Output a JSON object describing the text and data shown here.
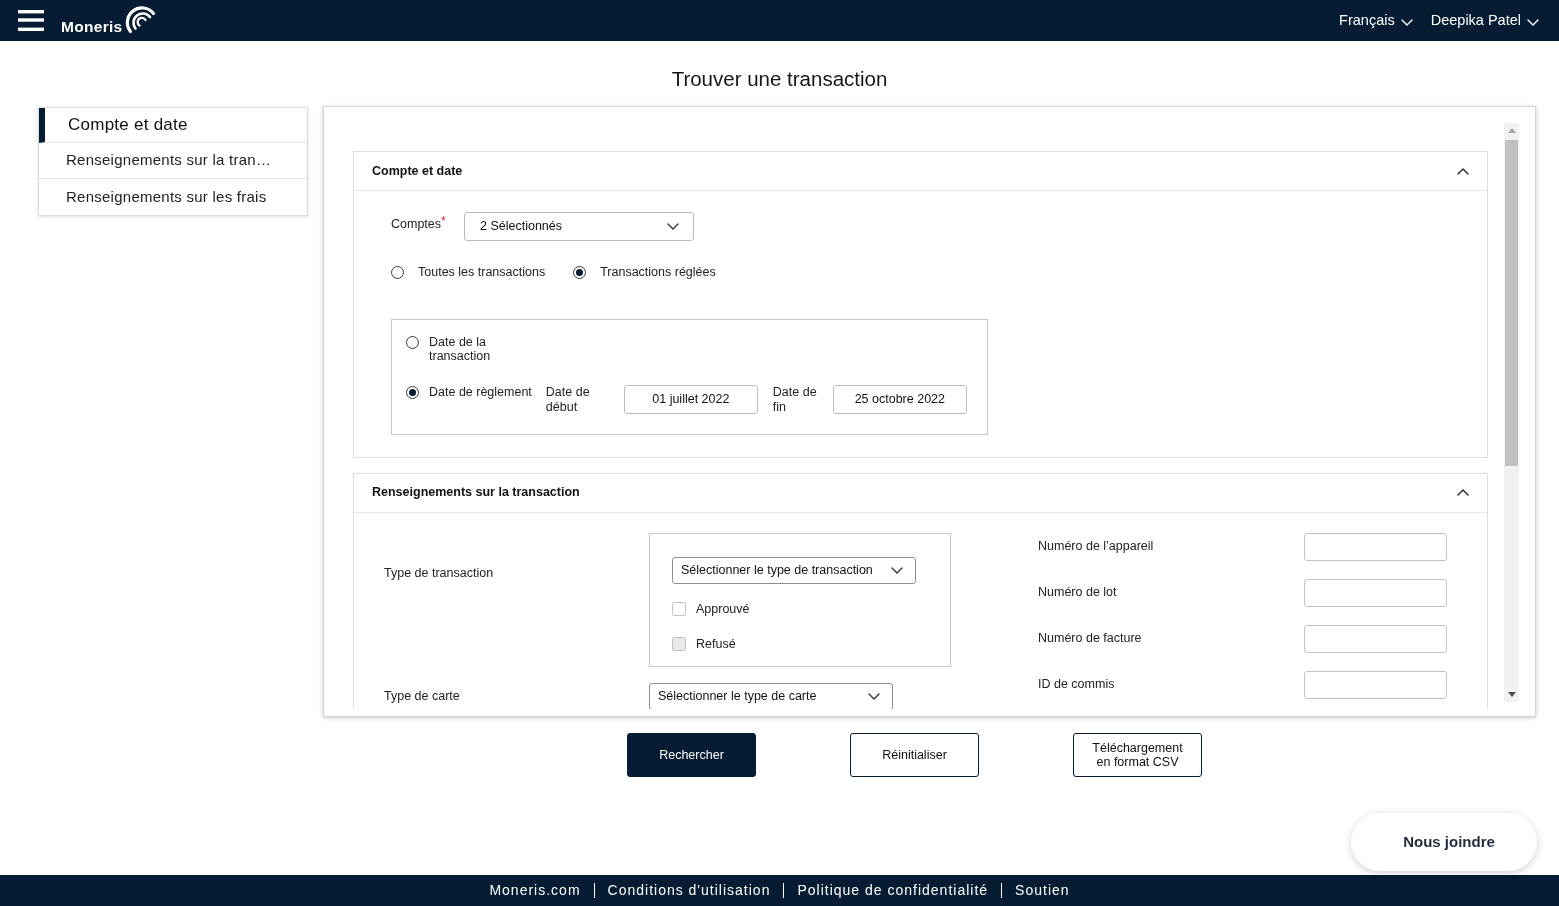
{
  "header": {
    "brand": "Moneris",
    "language": "Français",
    "user": "Deepika Patel"
  },
  "page_title": "Trouver une transaction",
  "sidebar": {
    "items": [
      {
        "label": "Compte et date",
        "selected": true
      },
      {
        "label": "Renseignements sur la tran…",
        "selected": false
      },
      {
        "label": "Renseignements sur les frais",
        "selected": false
      }
    ]
  },
  "sections": [
    {
      "kind": "account_date",
      "title": "Compte et date",
      "expanded": true,
      "accounts": {
        "label": "Comptes",
        "required_mark": "*",
        "value": "2 Sélectionnés"
      },
      "scope_options": [
        {
          "label": "Toutes les transactions",
          "selected": false
        },
        {
          "label": "Transactions réglées",
          "selected": true
        }
      ],
      "date_options": [
        {
          "label": "Date de la transaction",
          "selected": false
        },
        {
          "label": "Date de règlement",
          "selected": true,
          "start": {
            "label": "Date de début",
            "value": "01 juillet 2022"
          },
          "end": {
            "label": "Date de fin",
            "value": "25 octobre 2022"
          }
        }
      ]
    },
    {
      "kind": "transaction",
      "title": "Renseignements sur la transaction",
      "expanded": true,
      "transaction_type": {
        "label": "Type de transaction",
        "value": "Sélectionner le type de transaction",
        "statuses": [
          {
            "label": "Approuvé",
            "checked": false,
            "disabled": false
          },
          {
            "label": "Refusé",
            "checked": false,
            "disabled": true
          }
        ]
      },
      "card_type": {
        "label": "Type de carte",
        "value": "Sélectionner le type de carte"
      },
      "fields": [
        {
          "label": "Numéro de l’appareil"
        },
        {
          "label": "Numéro de lot"
        },
        {
          "label": "Numéro de facture"
        },
        {
          "label": "ID de commis"
        }
      ]
    }
  ],
  "actions": [
    {
      "label": "Rechercher",
      "kind": "primary"
    },
    {
      "label": "Réinitialiser",
      "kind": "secondary"
    },
    {
      "label": "Téléchargement en format CSV",
      "kind": "secondary"
    }
  ],
  "contact_button": "Nous joindre",
  "footer": {
    "links": [
      "Moneris.com",
      "Conditions d'utilisation",
      "Politique de confidentialité",
      "Soutien"
    ]
  }
}
